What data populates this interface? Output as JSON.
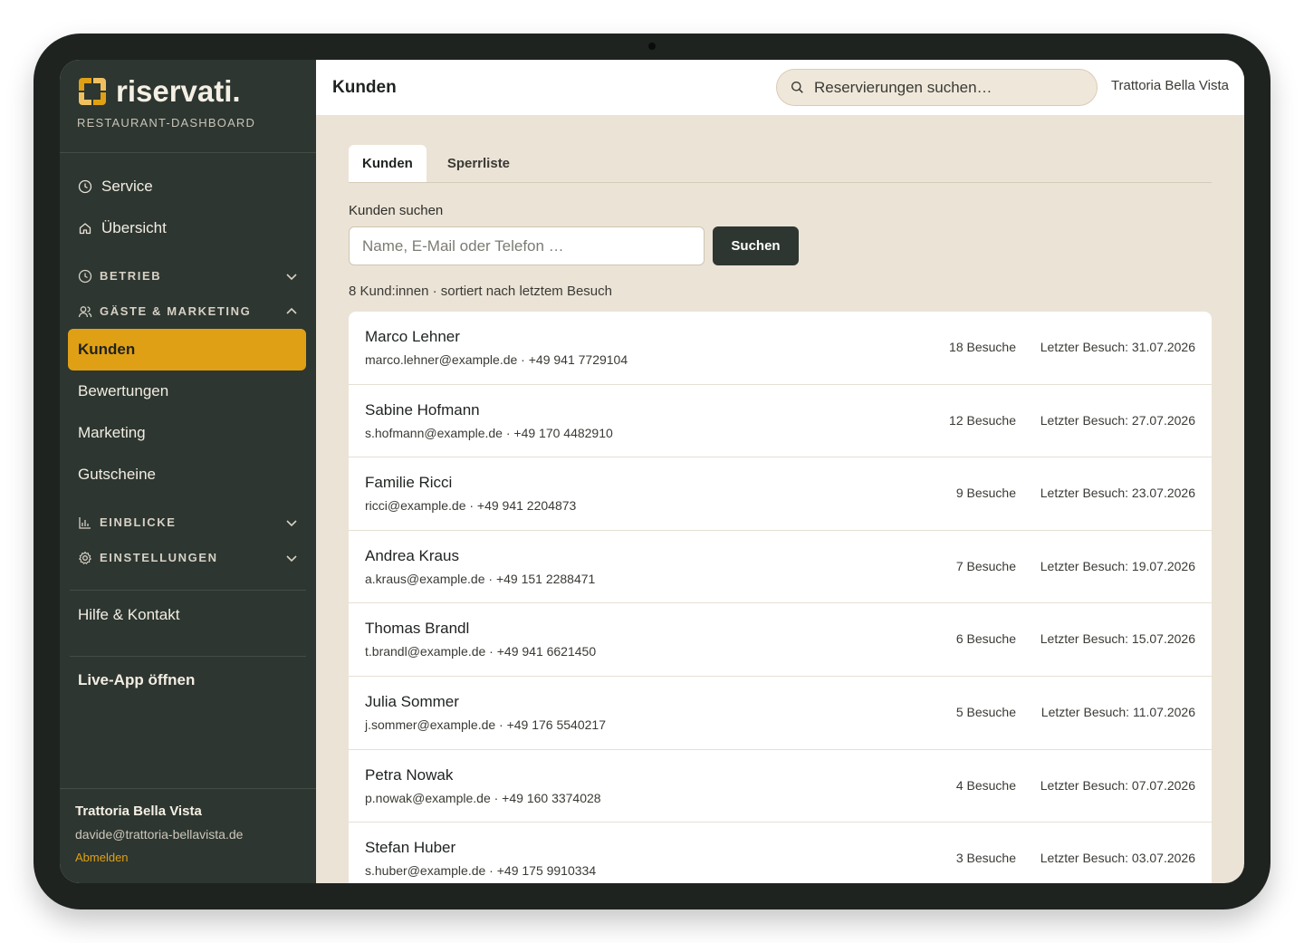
{
  "brand": {
    "name": "riservati.",
    "subtitle": "RESTAURANT-DASHBOARD",
    "accent": "#e0a015",
    "sidebar_bg": "#2d3630"
  },
  "nav": {
    "service": "Service",
    "overview": "Übersicht",
    "groups": {
      "betrieb": "BETRIEB",
      "gaeste": "GÄSTE & MARKETING",
      "einblicke": "EINBLICKE",
      "einstellungen": "EINSTELLUNGEN"
    },
    "sub": {
      "kunden": "Kunden",
      "bewertungen": "Bewertungen",
      "marketing": "Marketing",
      "gutscheine": "Gutscheine"
    },
    "help": "Hilfe & Kontakt",
    "live": "Live-App öffnen"
  },
  "account": {
    "name": "Trattoria Bella Vista",
    "email": "davide@trattoria-bellavista.de",
    "logout": "Abmelden"
  },
  "topbar": {
    "title": "Kunden",
    "search_placeholder": "Reservierungen suchen…",
    "venue": "Trattoria Bella Vista"
  },
  "tabs": [
    "Kunden",
    "Sperrliste"
  ],
  "customer_search": {
    "label": "Kunden suchen",
    "placeholder": "Name, E-Mail oder Telefon …",
    "button": "Suchen"
  },
  "result_info": "8 Kund:innen · sortiert nach letztem Besuch",
  "customers": [
    {
      "name": "Marco Lehner",
      "contact": "marco.lehner@example.de · +49 941 7729104",
      "visits": "18 Besuche",
      "last": "Letzter Besuch: 31.07.2026"
    },
    {
      "name": "Sabine Hofmann",
      "contact": "s.hofmann@example.de · +49 170 4482910",
      "visits": "12 Besuche",
      "last": "Letzter Besuch: 27.07.2026"
    },
    {
      "name": "Familie Ricci",
      "contact": "ricci@example.de · +49 941 2204873",
      "visits": "9 Besuche",
      "last": "Letzter Besuch: 23.07.2026"
    },
    {
      "name": "Andrea Kraus",
      "contact": "a.kraus@example.de · +49 151 2288471",
      "visits": "7 Besuche",
      "last": "Letzter Besuch: 19.07.2026"
    },
    {
      "name": "Thomas Brandl",
      "contact": "t.brandl@example.de · +49 941 6621450",
      "visits": "6 Besuche",
      "last": "Letzter Besuch: 15.07.2026"
    },
    {
      "name": "Julia Sommer",
      "contact": "j.sommer@example.de · +49 176 5540217",
      "visits": "5 Besuche",
      "last": "Letzter Besuch: 11.07.2026"
    },
    {
      "name": "Petra Nowak",
      "contact": "p.nowak@example.de · +49 160 3374028",
      "visits": "4 Besuche",
      "last": "Letzter Besuch: 07.07.2026"
    },
    {
      "name": "Stefan Huber",
      "contact": "s.huber@example.de · +49 175 9910334",
      "visits": "3 Besuche",
      "last": "Letzter Besuch: 03.07.2026"
    }
  ]
}
